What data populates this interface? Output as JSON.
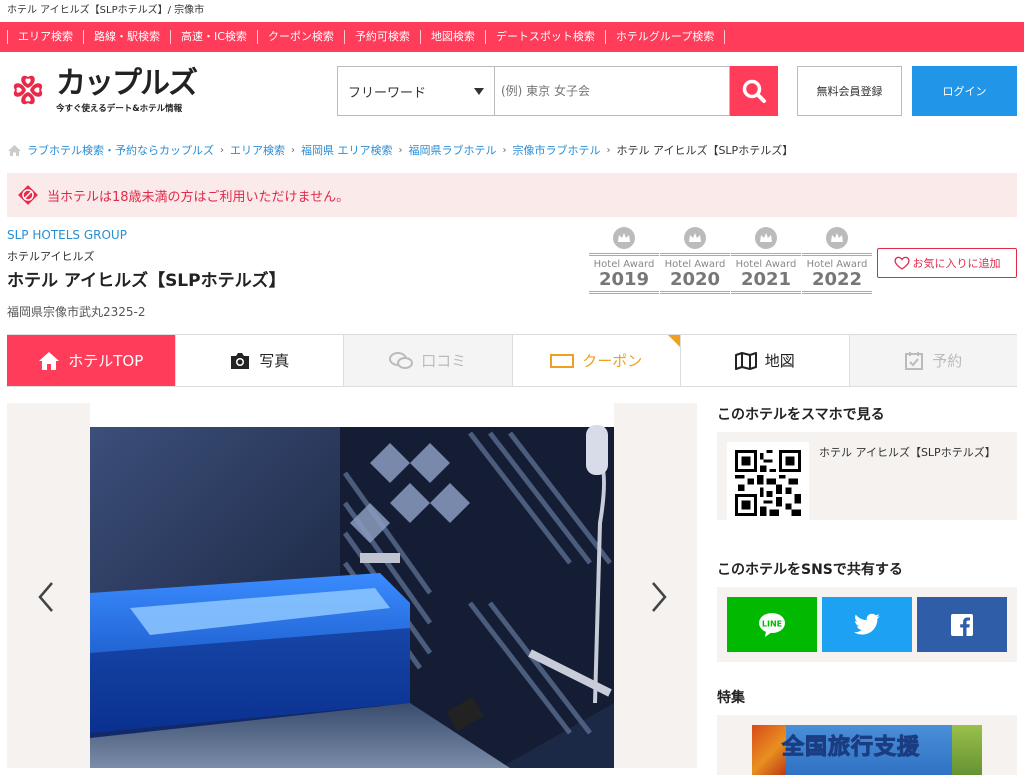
{
  "topline": "ホテル アイヒルズ【SLPホテルズ】/ 宗像市",
  "nav": [
    "エリア検索",
    "路線・駅検索",
    "高速・IC検索",
    "クーポン検索",
    "予約可検索",
    "地図検索",
    "デートスポット検索",
    "ホテルグループ検索"
  ],
  "logo": {
    "main": "カップルズ",
    "sub": "今すぐ使えるデート&ホテル情報"
  },
  "search": {
    "select_value": "フリーワード",
    "placeholder": "(例) 東京 女子会"
  },
  "header_buttons": {
    "register": "無料会員登録",
    "login": "ログイン"
  },
  "breadcrumb": [
    "ラブホテル検索・予約ならカップルズ",
    "エリア検索",
    "福岡県 エリア検索",
    "福岡県ラブホテル",
    "宗像市ラブホテル"
  ],
  "breadcrumb_current": "ホテル アイヒルズ【SLPホテルズ】",
  "warning": "当ホテルは18歳未満の方はご利用いただけません。",
  "hotel": {
    "group": "SLP HOTELS GROUP",
    "kana": "ホテルアイヒルズ",
    "name": "ホテル アイヒルズ【SLPホテルズ】",
    "address": "福岡県宗像市武丸2325-2"
  },
  "awards": [
    {
      "label": "Hotel Award",
      "year": "2019"
    },
    {
      "label": "Hotel Award",
      "year": "2020"
    },
    {
      "label": "Hotel Award",
      "year": "2021"
    },
    {
      "label": "Hotel Award",
      "year": "2022"
    }
  ],
  "favorite": "お気に入りに追加",
  "tabs": [
    "ホテルTOP",
    "写真",
    "口コミ",
    "クーポン",
    "地図",
    "予約"
  ],
  "sidebar": {
    "smartphone_title": "このホテルをスマホで見る",
    "smartphone_hotel": "ホテル アイヒルズ【SLPホテルズ】",
    "sns_title": "このホテルをSNSで共有する",
    "feature_title": "特集",
    "banner_text": "全国旅行支援"
  },
  "colors": {
    "brand_red": "#ff3c5a",
    "login_blue": "#2196e8",
    "line_green": "#00b900",
    "twitter_blue": "#1da1f2",
    "facebook_blue": "#2f5da8"
  }
}
